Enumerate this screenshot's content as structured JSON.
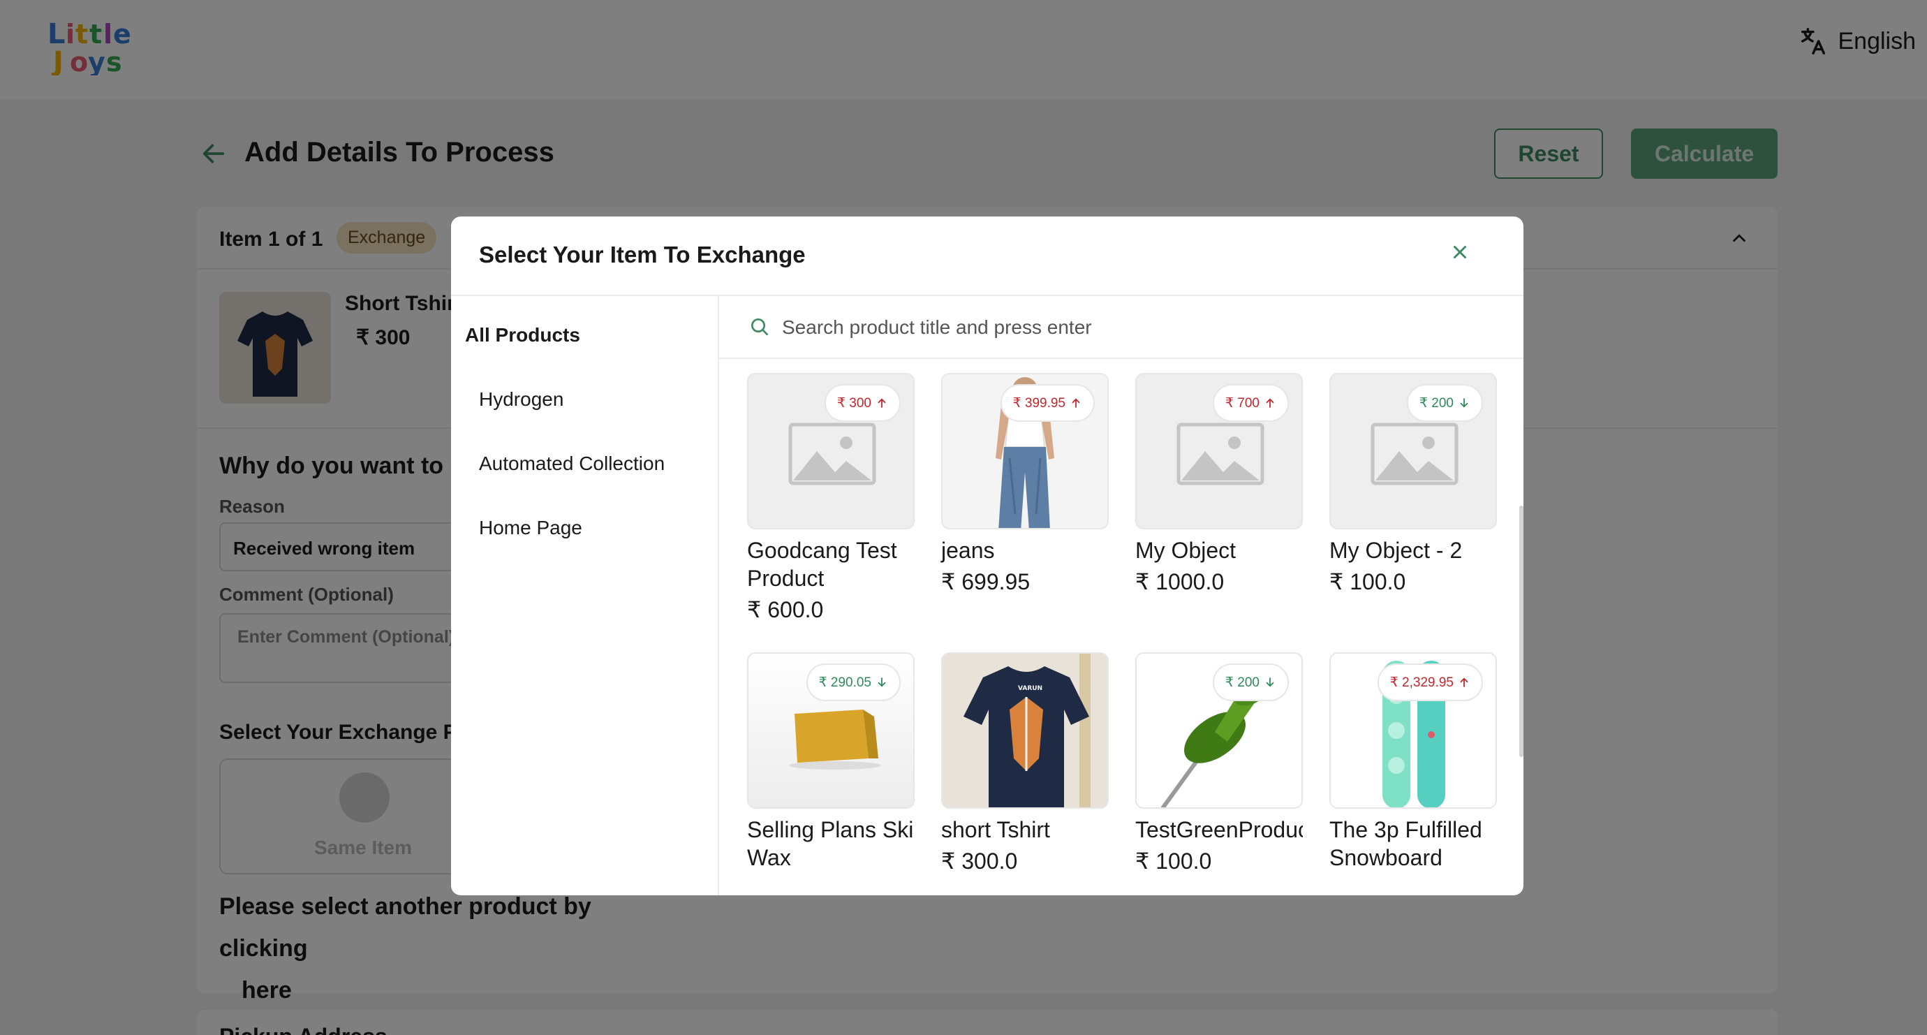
{
  "header": {
    "brand": "Little Joys",
    "language": "English"
  },
  "page": {
    "title": "Add Details To Process",
    "reset_label": "Reset",
    "calculate_label": "Calculate",
    "item_count": "Item 1 of 1",
    "item_type_badge": "Exchange",
    "product_name": "Short Tshir",
    "product_price": "₹ 300",
    "why_heading": "Why do you want to ex",
    "reason_label": "Reason",
    "reason_value": "Received wrong item",
    "comment_label": "Comment (Optional)",
    "comment_placeholder": "Enter Comment (Optional)",
    "select_exchange_label": "Select Your Exchange Pr",
    "same_item_label": "Same Item",
    "please_text": "Please select another product by clicking",
    "here_text": "here",
    "pickup_title": "Pickup Address"
  },
  "modal": {
    "title": "Select Your Item To Exchange",
    "search_placeholder": "Search product title and press enter",
    "collections": [
      {
        "label": "All Products",
        "active": true
      },
      {
        "label": "Hydrogen",
        "active": false
      },
      {
        "label": "Automated Collection",
        "active": false
      },
      {
        "label": "Home Page",
        "active": false
      }
    ],
    "products": [
      {
        "name": "Goodcang Test Product",
        "price": "₹ 600.0",
        "diff": "₹ 300",
        "direction": "up",
        "image": "placeholder"
      },
      {
        "name": "jeans",
        "price": "₹ 699.95",
        "diff": "₹ 399.95",
        "direction": "up",
        "image": "jeans"
      },
      {
        "name": "My Object",
        "price": "₹ 1000.0",
        "diff": "₹ 700",
        "direction": "up",
        "image": "placeholder"
      },
      {
        "name": "My Object - 2",
        "price": "₹ 100.0",
        "diff": "₹ 200",
        "direction": "down",
        "image": "placeholder"
      },
      {
        "name": "Selling Plans Ski Wax",
        "price": "",
        "diff": "₹ 290.05",
        "direction": "down",
        "image": "wax"
      },
      {
        "name": "short Tshirt",
        "price": "₹ 300.0",
        "diff": "",
        "direction": "",
        "image": "tshirt"
      },
      {
        "name": "TestGreenProduct",
        "price": "₹ 100.0",
        "diff": "₹ 200",
        "direction": "down",
        "image": "pin"
      },
      {
        "name": "The 3p Fulfilled Snowboard",
        "price": "",
        "diff": "₹ 2,329.95",
        "direction": "up",
        "image": "snowboard"
      }
    ]
  },
  "colors": {
    "accent": "#3e8b63",
    "price_up": "#c0272d",
    "price_down": "#2e8a5a"
  }
}
